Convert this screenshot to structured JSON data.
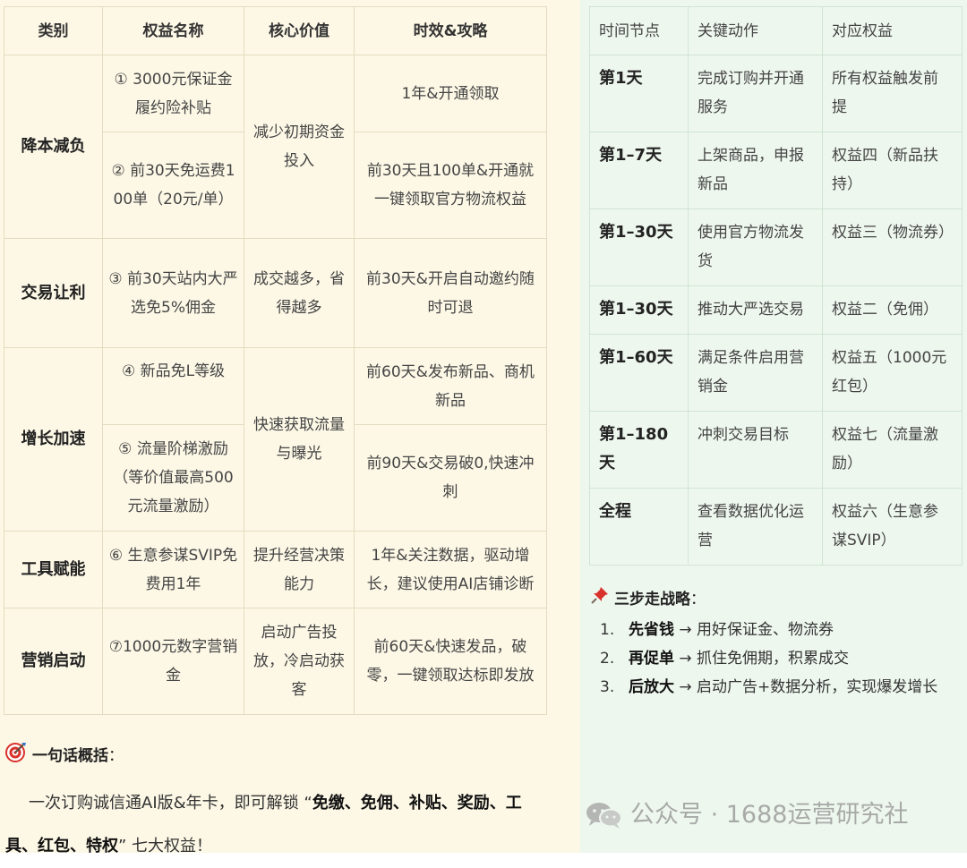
{
  "benefit_table": {
    "headers": [
      "类别",
      "权益名称",
      "核心价值",
      "时效&攻略"
    ],
    "groups": [
      {
        "category": "降本减负",
        "value": "减少初期资金投入",
        "items": [
          {
            "name": "① 3000元保证金履约险补贴",
            "timing": "1年&开通领取"
          },
          {
            "name": "② 前30天免运费100单（20元/单）",
            "timing": "前30天且100单&开通就一键领取官方物流权益"
          }
        ]
      },
      {
        "category": "交易让利",
        "value": "成交越多，省得越多",
        "items": [
          {
            "name": "③ 前30天站内大严选免5%佣金",
            "timing": "前30天&开启自动邀约随时可退"
          }
        ]
      },
      {
        "category": "增长加速",
        "value": "快速获取流量与曝光",
        "items": [
          {
            "name": "④ 新品免L等级",
            "timing": "前60天&发布新品、商机新品"
          },
          {
            "name": "⑤ 流量阶梯激励（等价值最高500元流量激励）",
            "timing": "前90天&交易破0,快速冲刺"
          }
        ]
      },
      {
        "category": "工具赋能",
        "value": "提升经营决策能力",
        "items": [
          {
            "name": "⑥ 生意参谋SVIP免费用1年",
            "timing": "1年&关注数据，驱动增长，建议使用AI店铺诊断"
          }
        ]
      },
      {
        "category": "营销启动",
        "value": "启动广告投放，冷启动获客",
        "items": [
          {
            "name": "⑦1000元数字营销金",
            "timing": "前60天&快速发品，破零，一键领取达标即发放"
          }
        ]
      }
    ]
  },
  "timeline_table": {
    "headers": [
      "时间节点",
      "关键动作",
      "对应权益"
    ],
    "rows": [
      {
        "day": "第1天",
        "action": "完成订购并开通服务",
        "benefit": "所有权益触发前提"
      },
      {
        "day": "第1–7天",
        "action": "上架商品，申报新品",
        "benefit": "权益四（新品扶持）"
      },
      {
        "day": "第1–30天",
        "action": "使用官方物流发货",
        "benefit": "权益三（物流券）"
      },
      {
        "day": "第1–30天",
        "action": "推动大严选交易",
        "benefit": "权益二（免佣）"
      },
      {
        "day": "第1–60天",
        "action": "满足条件启用营销金",
        "benefit": "权益五（1000元红包）"
      },
      {
        "day": "第1–180天",
        "action": "冲刺交易目标",
        "benefit": "权益七（流量激励）"
      },
      {
        "day": "全程",
        "action": "查看数据优化运营",
        "benefit": "权益六（生意参谋SVIP）"
      }
    ]
  },
  "summary": {
    "title": "一句话概括",
    "colon": "：",
    "text_before": "一次订购诚信通AI版&年卡，即可解锁 “",
    "text_bold": "免缴、免佣、补贴、奖励、工具、红包、特权",
    "text_after": "” 七大权益！"
  },
  "strategy": {
    "title": "三步走战略",
    "colon": "：",
    "steps": [
      {
        "num": "1.",
        "bold": "先省钱",
        "rest": " → 用好保证金、物流券"
      },
      {
        "num": "2.",
        "bold": "再促单",
        "rest": " → 抓住免佣期，积累成交"
      },
      {
        "num": "3.",
        "bold": "后放大",
        "rest": " → 启动广告+数据分析，实现爆发增长"
      }
    ]
  },
  "watermark": {
    "text": "公众号 · 1688运营研究社"
  },
  "icons": {
    "summary": "target-icon",
    "strategy": "pushpin-icon",
    "watermark": "wechat-icon"
  },
  "colors": {
    "left_bg": "#fdf8e6",
    "right_bg": "#eef7ee",
    "pin": "#d9312b",
    "target": "#d9312b"
  }
}
